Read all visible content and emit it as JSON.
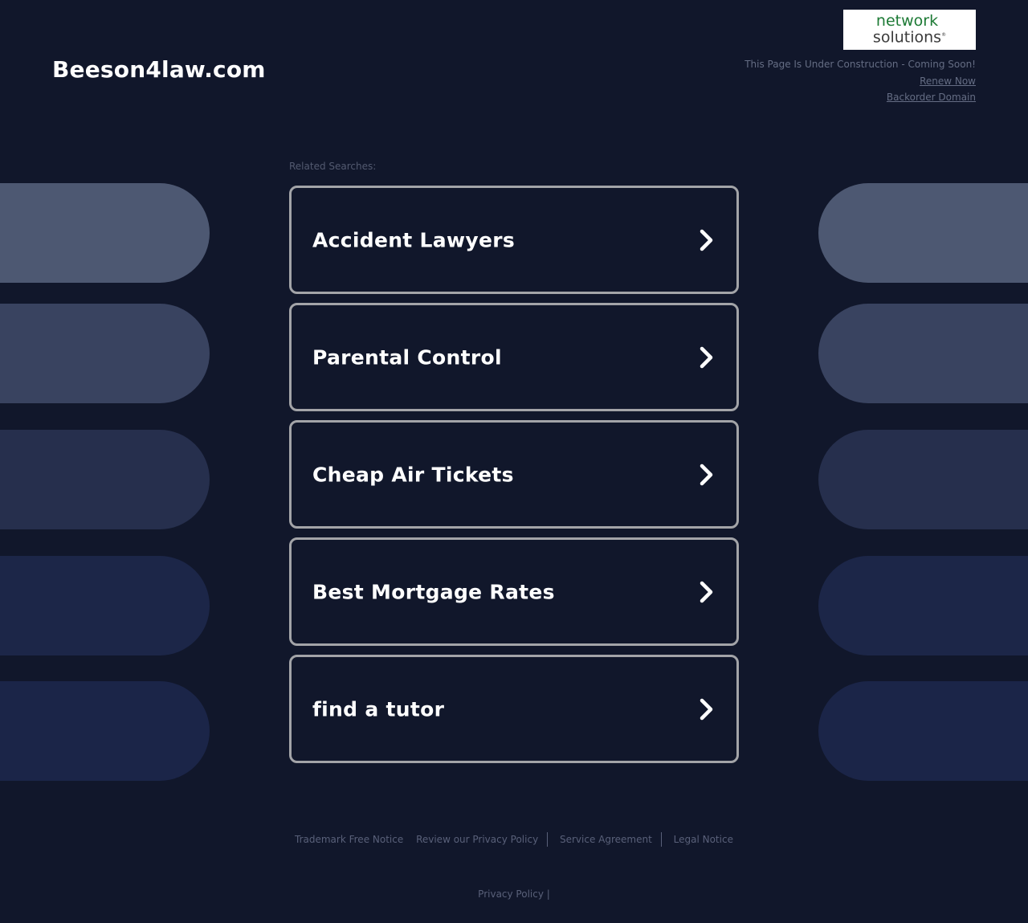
{
  "header": {
    "site_title": "Beeson4law.com",
    "logo": {
      "line1": "network",
      "line2": "solutions",
      "mark": "®"
    },
    "status_text": "This Page Is Under Construction - Coming Soon!",
    "renew_link": "Renew Now",
    "backorder_link": "Backorder Domain"
  },
  "related": {
    "label": "Related Searches:",
    "items": [
      {
        "label": "Accident Lawyers"
      },
      {
        "label": "Parental Control"
      },
      {
        "label": "Cheap Air Tickets"
      },
      {
        "label": "Best Mortgage Rates"
      },
      {
        "label": "find a tutor"
      }
    ]
  },
  "footer": {
    "links": [
      "Trademark Free Notice",
      "Review our Privacy Policy",
      "Service Agreement",
      "Legal Notice"
    ],
    "privacy_policy": "Privacy Policy",
    "privacy_sep": "|"
  },
  "colors": {
    "background": "#11172b",
    "card_border": "#a3a4a8",
    "logo_green": "#1d7a35"
  }
}
